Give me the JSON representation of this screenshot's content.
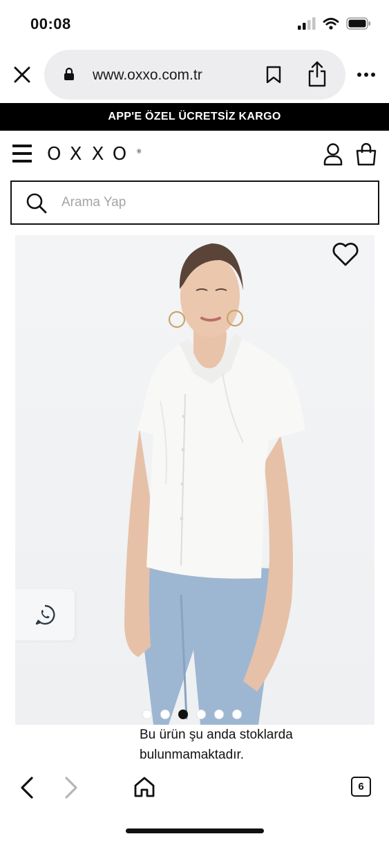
{
  "status_bar": {
    "time": "00:08",
    "icons": [
      "cellular-signal-icon",
      "wifi-icon",
      "battery-icon"
    ]
  },
  "browser": {
    "url": "www.oxxo.com.tr",
    "icons": [
      "close-icon",
      "lock-icon",
      "bookmark-icon",
      "share-icon",
      "more-icon"
    ]
  },
  "promo": {
    "text": "APP'E ÖZEL ÜCRETSİZ KARGO",
    "background": "#000000",
    "color": "#ffffff"
  },
  "header": {
    "logo": "OXXO",
    "logo_mark": "®",
    "icons": [
      "menu-icon",
      "user-icon",
      "shopping-bag-icon"
    ]
  },
  "search": {
    "placeholder": "Arama Yap",
    "value": ""
  },
  "product": {
    "carousel": {
      "total": 6,
      "active_index": 2
    },
    "favorite_icon": "heart-icon",
    "whatsapp_icon": "whatsapp-icon",
    "stock_message_line1": "Bu ürün şu anda stoklarda",
    "stock_message_line2": "bulunmamaktadır."
  },
  "toolbar": {
    "tab_count": "6",
    "icons": [
      "back-icon",
      "forward-icon",
      "home-icon",
      "tabs-icon"
    ]
  }
}
